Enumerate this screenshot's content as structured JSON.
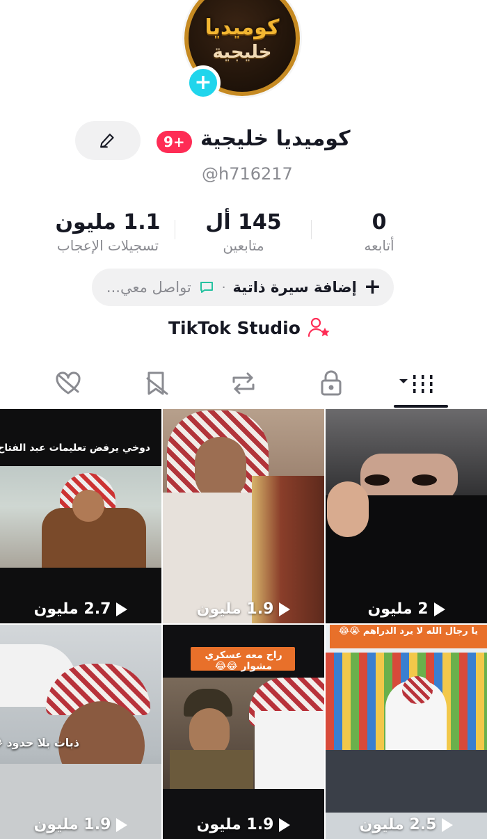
{
  "profile": {
    "avatar_logo_line1": "كوميديا",
    "avatar_logo_line2": "خليجية",
    "add_symbol": "+",
    "name": "كوميديا خليجية",
    "badge": "9+",
    "handle": "@h716217"
  },
  "stats": {
    "likes": {
      "value": "1.1 مليون",
      "label": "تسجيلات الإعجاب"
    },
    "followers": {
      "value": "145 أل",
      "label": "متابعين"
    },
    "following": {
      "value": "0",
      "label": "أتابعه"
    }
  },
  "bio": {
    "plus": "+",
    "add_label": "إضافة سيرة ذاتية",
    "separator": "·",
    "contact_label": "تواصل معي..."
  },
  "studio": {
    "label": "TikTok Studio"
  },
  "tabs": [
    {
      "name": "videos",
      "icon": "grid-icon",
      "active": true
    },
    {
      "name": "private",
      "icon": "lock-icon"
    },
    {
      "name": "reposts",
      "icon": "repost-icon"
    },
    {
      "name": "favorites",
      "icon": "bookmark-icon"
    },
    {
      "name": "liked",
      "icon": "heart-icon"
    }
  ],
  "videos": [
    {
      "views": "2.7 مليون",
      "caption": "دوخي يرفض تعليمات عبد الفتاح 😂"
    },
    {
      "views": "1.9 مليون",
      "caption": ""
    },
    {
      "views": "2 مليون",
      "caption": ""
    },
    {
      "views": "1.9 مليون",
      "caption": "ذبات بلا حدود 😂"
    },
    {
      "views": "1.9 مليون",
      "caption": "راح معه عسكري مشوار 😂😂"
    },
    {
      "views": "2.5 مليون",
      "caption": "يا رجال الله لا يرد الدراهم 😭😂"
    }
  ],
  "colors": {
    "accent_pink": "#fe2c55",
    "accent_cyan": "#20d5ec",
    "muted_text": "#8a8b91"
  }
}
